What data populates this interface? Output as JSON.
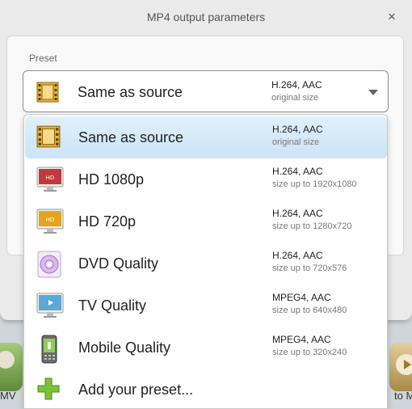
{
  "dialog": {
    "title": "MP4 output parameters",
    "close_label": "×",
    "preset_label": "Preset"
  },
  "combo": {
    "name": "Same as source",
    "codec": "H.264, AAC",
    "size": "original size",
    "icon": "film-icon"
  },
  "options": [
    {
      "name": "Same as source",
      "codec": "H.264, AAC",
      "size": "original size",
      "icon": "film-icon",
      "selected": true
    },
    {
      "name": "HD 1080p",
      "codec": "H.264, AAC",
      "size": "size up to 1920x1080",
      "icon": "hd-monitor-red-icon"
    },
    {
      "name": "HD 720p",
      "codec": "H.264, AAC",
      "size": "size up to 1280x720",
      "icon": "hd-monitor-yellow-icon"
    },
    {
      "name": "DVD Quality",
      "codec": "H.264, AAC",
      "size": "size up to 720x576",
      "icon": "dvd-disc-icon"
    },
    {
      "name": "TV Quality",
      "codec": "MPEG4, AAC",
      "size": "size up to 640x480",
      "icon": "tv-icon"
    },
    {
      "name": "Mobile Quality",
      "codec": "MPEG4, AAC",
      "size": "size up to 320x240",
      "icon": "mobile-phone-icon"
    },
    {
      "name": "Add your preset...",
      "icon": "plus-icon"
    }
  ],
  "hd_badge": "HD",
  "background": {
    "left_label": "MV",
    "right_label": "to M"
  },
  "colors": {
    "selection": "#cbe4f6",
    "hd_red": "#c0393b",
    "hd_yellow": "#e5a31a",
    "plus_green": "#6fb628"
  }
}
